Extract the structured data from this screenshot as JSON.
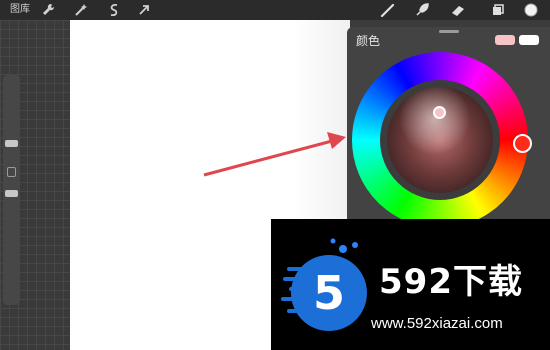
{
  "topbar": {
    "gallery_label": "图库",
    "left_tools": [
      "wrench-icon",
      "magic-wand-icon",
      "selection-icon",
      "transform-arrow-icon"
    ],
    "right_tools": [
      "brush-icon",
      "smudge-icon",
      "eraser-icon",
      "layers-icon",
      "color-swatch-icon"
    ]
  },
  "color_panel": {
    "title": "颜色",
    "current_color": "#f6c4c4",
    "previous_color": "#ffffff",
    "selected_hue": "#ff2a1a"
  },
  "watermark": {
    "brand": "592下载",
    "url": "www.592xiazai.com",
    "logo_text": "5"
  },
  "colors": {
    "accent_arrow": "#e0464e",
    "logo_blue": "#1b6fd6"
  }
}
